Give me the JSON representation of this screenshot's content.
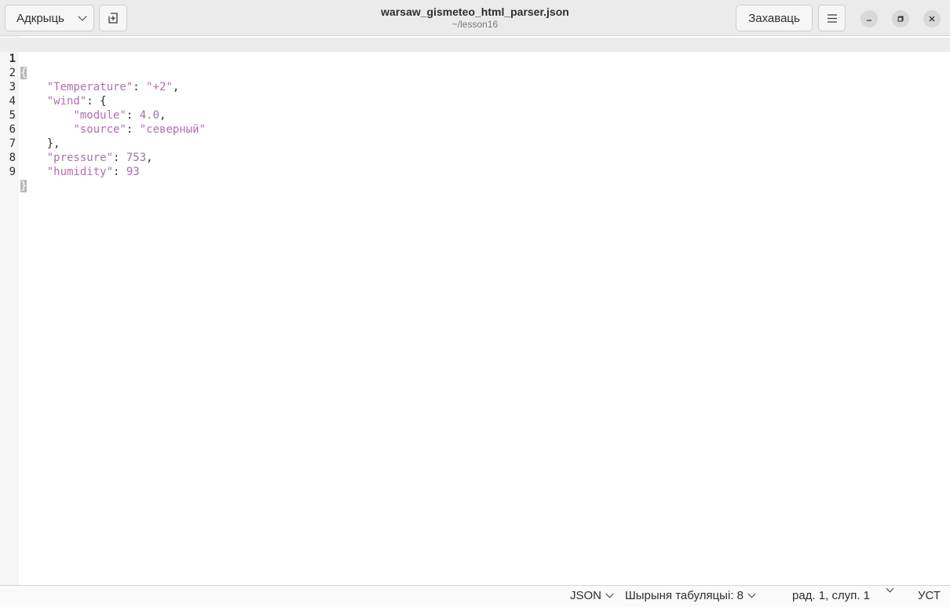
{
  "header": {
    "open_label": "Адкрыць",
    "title": "warsaw_gismeteo_html_parser.json",
    "subtitle": "~/lesson16",
    "save_label": "Захаваць"
  },
  "editor": {
    "lines": [
      {
        "num": "1"
      },
      {
        "num": "2"
      },
      {
        "num": "3"
      },
      {
        "num": "4"
      },
      {
        "num": "5"
      },
      {
        "num": "6"
      },
      {
        "num": "7"
      },
      {
        "num": "8"
      },
      {
        "num": "9"
      }
    ],
    "tokens": {
      "open_brace": "{",
      "key_temperature": "\"Temperature\"",
      "val_temperature": "\"+2\"",
      "key_wind": "\"wind\"",
      "key_module": "\"module\"",
      "val_module": "4.0",
      "key_source": "\"source\"",
      "val_source": "\"северный\"",
      "close_wind": "},",
      "key_pressure": "\"pressure\"",
      "val_pressure": "753",
      "key_humidity": "\"humidity\"",
      "val_humidity": "93",
      "close_brace": "}"
    }
  },
  "statusbar": {
    "language": "JSON",
    "tab_width": "Шырыня табуляцыі: 8",
    "position": "рад. 1, слуп. 1",
    "insert_mode": "УСТ"
  },
  "icons": {
    "new_tab": "new-tab-icon",
    "menu": "hamburger-menu-icon",
    "minimize": "minimize-icon",
    "maximize": "maximize-icon",
    "close": "close-icon"
  }
}
